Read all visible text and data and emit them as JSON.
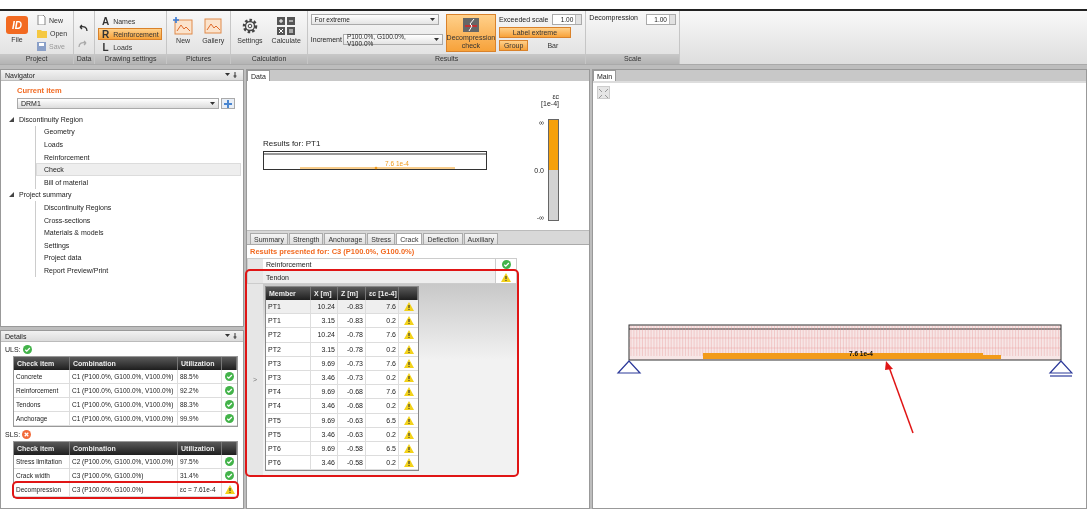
{
  "ribbon": {
    "groups": [
      {
        "kind": "project",
        "label": "Project",
        "logo": "ID",
        "file": "File",
        "items": [
          {
            "label": "New",
            "disabled": false
          },
          {
            "label": "Open",
            "disabled": false
          },
          {
            "label": "Save",
            "disabled": true
          }
        ]
      },
      {
        "kind": "history",
        "label": "Data",
        "items": [
          {
            "kind": "undo",
            "disabled": false
          },
          {
            "kind": "redo",
            "disabled": true
          }
        ]
      },
      {
        "kind": "toggles",
        "label": "Drawing settings",
        "items": [
          {
            "letter": "A",
            "label": "Names",
            "selected": false
          },
          {
            "letter": "R",
            "label": "Reinforcement",
            "selected": true
          },
          {
            "letter": "L",
            "label": "Loads",
            "selected": false
          }
        ]
      },
      {
        "kind": "big",
        "label": "Pictures",
        "items": [
          {
            "kind": "picture-new",
            "label": "New"
          },
          {
            "kind": "picture",
            "label": "Gallery"
          }
        ]
      },
      {
        "kind": "big",
        "label": "Calculation",
        "items": [
          {
            "kind": "gear",
            "label": "Settings"
          },
          {
            "kind": "grid",
            "label": "Calculate"
          }
        ]
      },
      {
        "kind": "results",
        "label": "Results",
        "mode": "For extreme",
        "increment_label": "Increment",
        "increment": "P100.0%, G100.0%, V100.0%",
        "check": {
          "label": "Decompression check",
          "selected": true
        },
        "scale_label": "Exceeded scale",
        "scale_value": "1.00",
        "toggles": [
          {
            "label": "Label extreme",
            "selected": true
          },
          {
            "label": "Group",
            "selected": true
          },
          {
            "label": "Bar",
            "selected": false
          }
        ]
      },
      {
        "kind": "scale",
        "label": "Scale",
        "field_label": "Decompression",
        "value": "1.00"
      }
    ]
  },
  "navigator": {
    "title": "Navigator",
    "current_label": "Current item",
    "current_value": "DRM1",
    "tree": [
      {
        "label": "Discontinuity Region",
        "expanded": true,
        "children": [
          {
            "label": "Geometry",
            "selected": false
          },
          {
            "label": "Loads",
            "selected": false
          },
          {
            "label": "Reinforcement",
            "selected": false
          },
          {
            "label": "Check",
            "selected": true
          },
          {
            "label": "Bill of material",
            "selected": false
          }
        ]
      },
      {
        "label": "Project summary",
        "expanded": true,
        "children": [
          {
            "label": "Discontinuity Regions",
            "selected": false
          },
          {
            "label": "Cross-sections",
            "selected": false
          },
          {
            "label": "Materials & models",
            "selected": false
          },
          {
            "label": "Settings",
            "selected": false
          },
          {
            "label": "Project data",
            "selected": false
          },
          {
            "label": "Report Preview/Print",
            "selected": false
          }
        ]
      }
    ]
  },
  "details": {
    "title": "Details",
    "sections": [
      {
        "label": "ULS:",
        "kind": "ok",
        "columns": [
          "Check item",
          "Combination",
          "Utilization"
        ],
        "rows": [
          {
            "item": "Concrete",
            "combination": "C1 (P100.0%, G100.0%, V100.0%)",
            "utilization": "88.5%",
            "kind": "ok",
            "highlighted": false
          },
          {
            "item": "Reinforcement",
            "combination": "C1 (P100.0%, G100.0%, V100.0%)",
            "utilization": "92.2%",
            "kind": "ok",
            "highlighted": false
          },
          {
            "item": "Tendons",
            "combination": "C1 (P100.0%, G100.0%, V100.0%)",
            "utilization": "88.3%",
            "kind": "ok",
            "highlighted": false
          },
          {
            "item": "Anchorage",
            "combination": "C1 (P100.0%, G100.0%, V100.0%)",
            "utilization": "99.9%",
            "kind": "ok",
            "highlighted": false
          }
        ]
      },
      {
        "label": "SLS:",
        "kind": "error",
        "columns": [
          "Check item",
          "Combination",
          "Utilization"
        ],
        "rows": [
          {
            "item": "Stress limitation",
            "combination": "C2 (P100.0%, G100.0%, V100.0%)",
            "utilization": "97.5%",
            "kind": "ok",
            "highlighted": false
          },
          {
            "item": "Crack width",
            "combination": "C3 (P100.0%, G100.0%)",
            "utilization": "31.4%",
            "kind": "ok",
            "highlighted": false
          },
          {
            "item": "Decompression",
            "combination": "C3 (P100.0%, G100.0%)",
            "utilization": "εc = 7.61e-4",
            "kind": "warning",
            "highlighted": true
          }
        ]
      }
    ]
  },
  "data": {
    "tab": "Data",
    "diagram": {
      "title": "Results for: PT1",
      "value_label": "7.6 1e-4",
      "legend_title": "εc",
      "legend_unit": "[1e-4]",
      "legend_max": "∞",
      "legend_mid": "0.0",
      "legend_min": "-∞"
    },
    "result_tabs": [
      {
        "label": "Summary",
        "selected": false
      },
      {
        "label": "Strength",
        "selected": false
      },
      {
        "label": "Anchorage",
        "selected": false
      },
      {
        "label": "Stress",
        "selected": false
      },
      {
        "label": "Crack",
        "selected": true
      },
      {
        "label": "Deflection",
        "selected": false
      },
      {
        "label": "Auxiliary",
        "selected": false
      }
    ],
    "caption": "Results presented for: C3 (P100.0%, G100.0%)",
    "checks": [
      {
        "label": "Reinforcement",
        "kind": "ok",
        "highlighted": false
      },
      {
        "label": "Tendon",
        "kind": "warning",
        "highlighted": true
      }
    ],
    "expander": ">",
    "table": {
      "columns": [
        "Member",
        "X [m]",
        "Z [m]",
        "εc [1e-4]"
      ],
      "rows": [
        {
          "cells": [
            "PT1",
            "10.24",
            "-0.83",
            "7.6"
          ],
          "kind": "warning",
          "selected": true
        },
        {
          "cells": [
            "PT1",
            "3.15",
            "-0.83",
            "0.2"
          ],
          "kind": "warning",
          "selected": false
        },
        {
          "cells": [
            "PT2",
            "10.24",
            "-0.78",
            "7.6"
          ],
          "kind": "warning",
          "selected": false
        },
        {
          "cells": [
            "PT2",
            "3.15",
            "-0.78",
            "0.2"
          ],
          "kind": "warning",
          "selected": false
        },
        {
          "cells": [
            "PT3",
            "9.69",
            "-0.73",
            "7.6"
          ],
          "kind": "warning",
          "selected": false
        },
        {
          "cells": [
            "PT3",
            "3.46",
            "-0.73",
            "0.2"
          ],
          "kind": "warning",
          "selected": false
        },
        {
          "cells": [
            "PT4",
            "9.69",
            "-0.68",
            "7.6"
          ],
          "kind": "warning",
          "selected": false
        },
        {
          "cells": [
            "PT4",
            "3.46",
            "-0.68",
            "0.2"
          ],
          "kind": "warning",
          "selected": false
        },
        {
          "cells": [
            "PT5",
            "9.69",
            "-0.63",
            "6.5"
          ],
          "kind": "warning",
          "selected": false
        },
        {
          "cells": [
            "PT5",
            "3.46",
            "-0.63",
            "0.2"
          ],
          "kind": "warning",
          "selected": false
        },
        {
          "cells": [
            "PT6",
            "9.69",
            "-0.58",
            "6.5"
          ],
          "kind": "warning",
          "selected": false
        },
        {
          "cells": [
            "PT6",
            "3.46",
            "-0.58",
            "0.2"
          ],
          "kind": "warning",
          "selected": false
        }
      ]
    }
  },
  "main": {
    "tab": "Main",
    "beam_label": "7.6 1e-4"
  }
}
